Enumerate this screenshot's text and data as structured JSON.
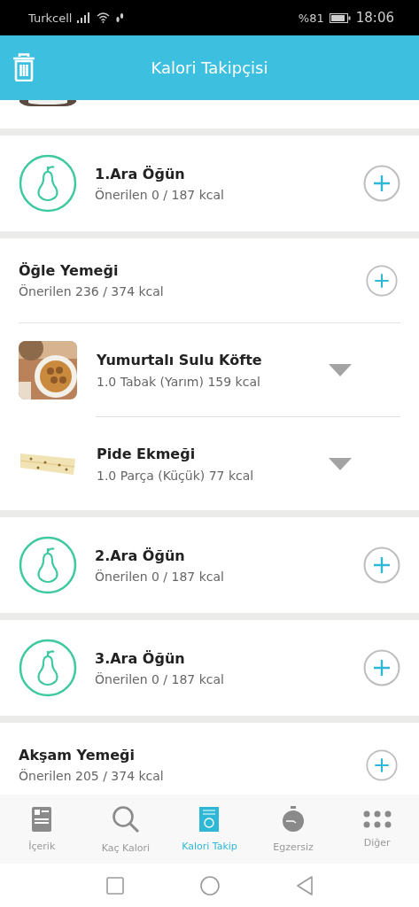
{
  "status_bar": {
    "carrier": "Turkcell",
    "battery": "%81",
    "time": "18:06"
  },
  "header": {
    "title": "Kalori Takipçisi"
  },
  "meals": [
    {
      "kind": "snack",
      "title": "1.Ara Öğün",
      "subtitle": "Önerilen 0 / 187 kcal"
    },
    {
      "kind": "meal",
      "title": "Öğle Yemeği",
      "subtitle": "Önerilen 236 / 374 kcal",
      "items": [
        {
          "name": "Yumurtalı Sulu Köfte",
          "portion": "1.0 Tabak (Yarım) 159 kcal",
          "kind": "soup"
        },
        {
          "name": "Pide Ekmeği",
          "portion": "1.0 Parça (Küçük) 77 kcal",
          "kind": "bread"
        }
      ]
    },
    {
      "kind": "snack",
      "title": "2.Ara Öğün",
      "subtitle": "Önerilen 0 / 187 kcal"
    },
    {
      "kind": "snack",
      "title": "3.Ara Öğün",
      "subtitle": "Önerilen 0 / 187 kcal"
    },
    {
      "kind": "meal",
      "title": "Akşam Yemeği",
      "subtitle": "Önerilen 205 / 374 kcal"
    }
  ],
  "tabs": [
    {
      "label": "İçerik",
      "kind": "content",
      "selected": false
    },
    {
      "label": "Kaç Kalori",
      "kind": "search",
      "selected": false
    },
    {
      "label": "Kalori Takip",
      "kind": "notepad",
      "selected": true
    },
    {
      "label": "Egzersiz",
      "kind": "stopwatch",
      "selected": false
    },
    {
      "label": "Diğer",
      "kind": "dots",
      "selected": false
    }
  ]
}
